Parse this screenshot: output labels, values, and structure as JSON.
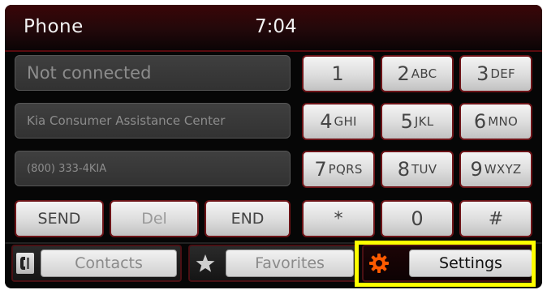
{
  "header": {
    "title": "Phone",
    "time": "7:04"
  },
  "fields": {
    "status": "Not connected",
    "contact_name": "Kia Consumer Assistance Center",
    "contact_number": "(800) 333-4KIA"
  },
  "keypad": [
    {
      "digit": "1",
      "letters": ""
    },
    {
      "digit": "2",
      "letters": "ABC"
    },
    {
      "digit": "3",
      "letters": "DEF"
    },
    {
      "digit": "4",
      "letters": "GHI"
    },
    {
      "digit": "5",
      "letters": "JKL"
    },
    {
      "digit": "6",
      "letters": "MNO"
    },
    {
      "digit": "7",
      "letters": "PQRS"
    },
    {
      "digit": "8",
      "letters": "TUV"
    },
    {
      "digit": "9",
      "letters": "WXYZ"
    },
    {
      "digit": "*",
      "letters": ""
    },
    {
      "digit": "0",
      "letters": ""
    },
    {
      "digit": "#",
      "letters": ""
    }
  ],
  "call_controls": {
    "send": "SEND",
    "del": "Del",
    "end": "END"
  },
  "bottom_bar": {
    "contacts": {
      "label": "Contacts",
      "icon": "phonebook-icon"
    },
    "favorites": {
      "label": "Favorites",
      "icon": "star-icon"
    },
    "settings": {
      "label": "Settings",
      "icon": "gear-icon"
    }
  },
  "colors": {
    "header_red": "#3a0608",
    "key_border": "#6d1418",
    "gear_orange": "#ff5a00",
    "highlight_yellow": "#ffff00"
  }
}
